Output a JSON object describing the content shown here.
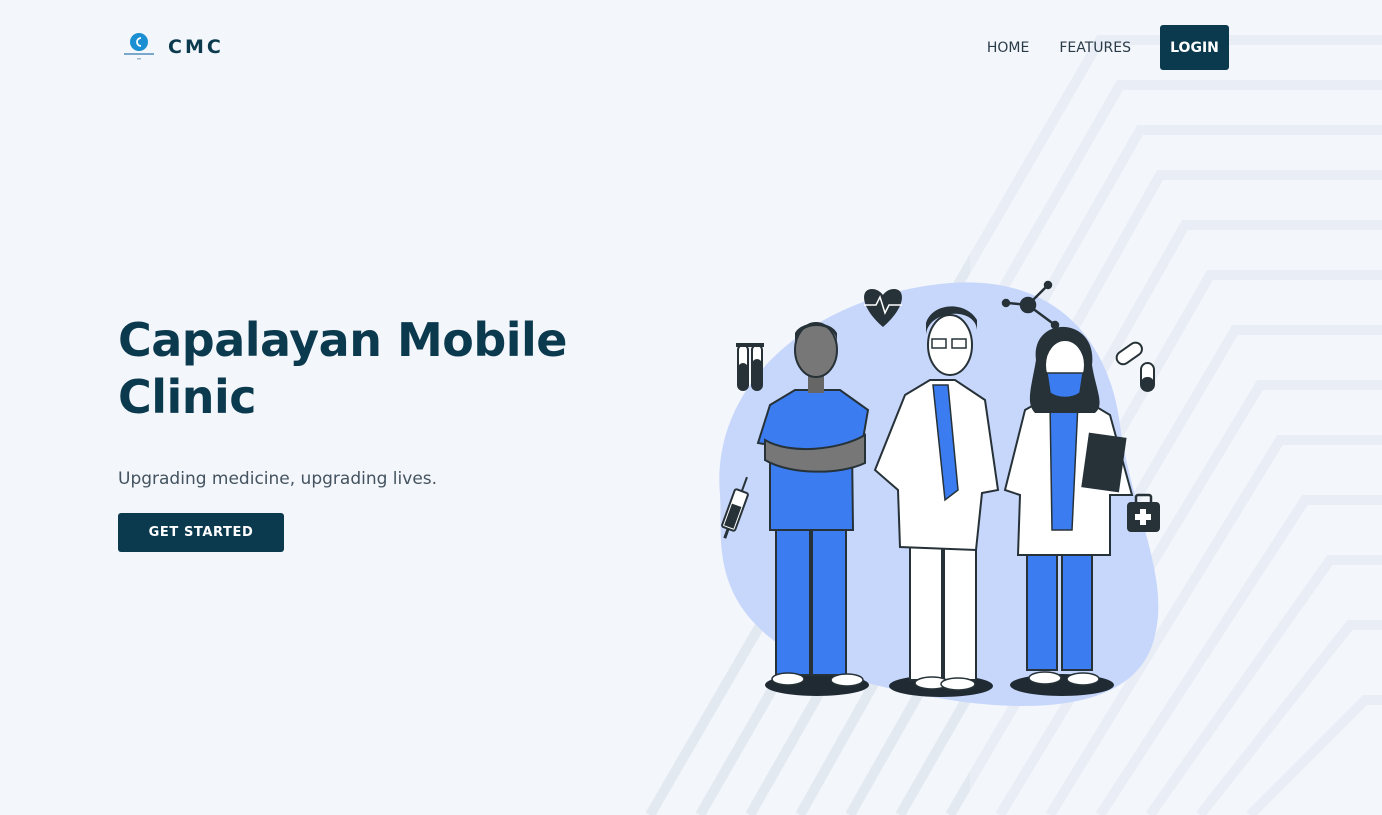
{
  "brand": {
    "name": "CMC",
    "logo_icon": "clinic-logo-icon"
  },
  "nav": {
    "home": "HOME",
    "features": "FEATURES",
    "login": "LOGIN"
  },
  "hero": {
    "title": "Capalayan Mobile Clinic",
    "subtitle": "Upgrading medicine, upgrading lives.",
    "cta": "GET STARTED"
  },
  "colors": {
    "primary": "#0b3a4e",
    "accent": "#3b7cf0",
    "blob": "#c7d6fb",
    "background": "#f3f6fb"
  },
  "illustration": {
    "icons": [
      "heart-rate-icon",
      "molecule-icon",
      "test-tubes-icon",
      "syringe-icon",
      "pill-icon",
      "first-aid-kit-icon"
    ],
    "figures": [
      "nurse-figure",
      "doctor-figure",
      "masked-doctor-figure"
    ]
  }
}
